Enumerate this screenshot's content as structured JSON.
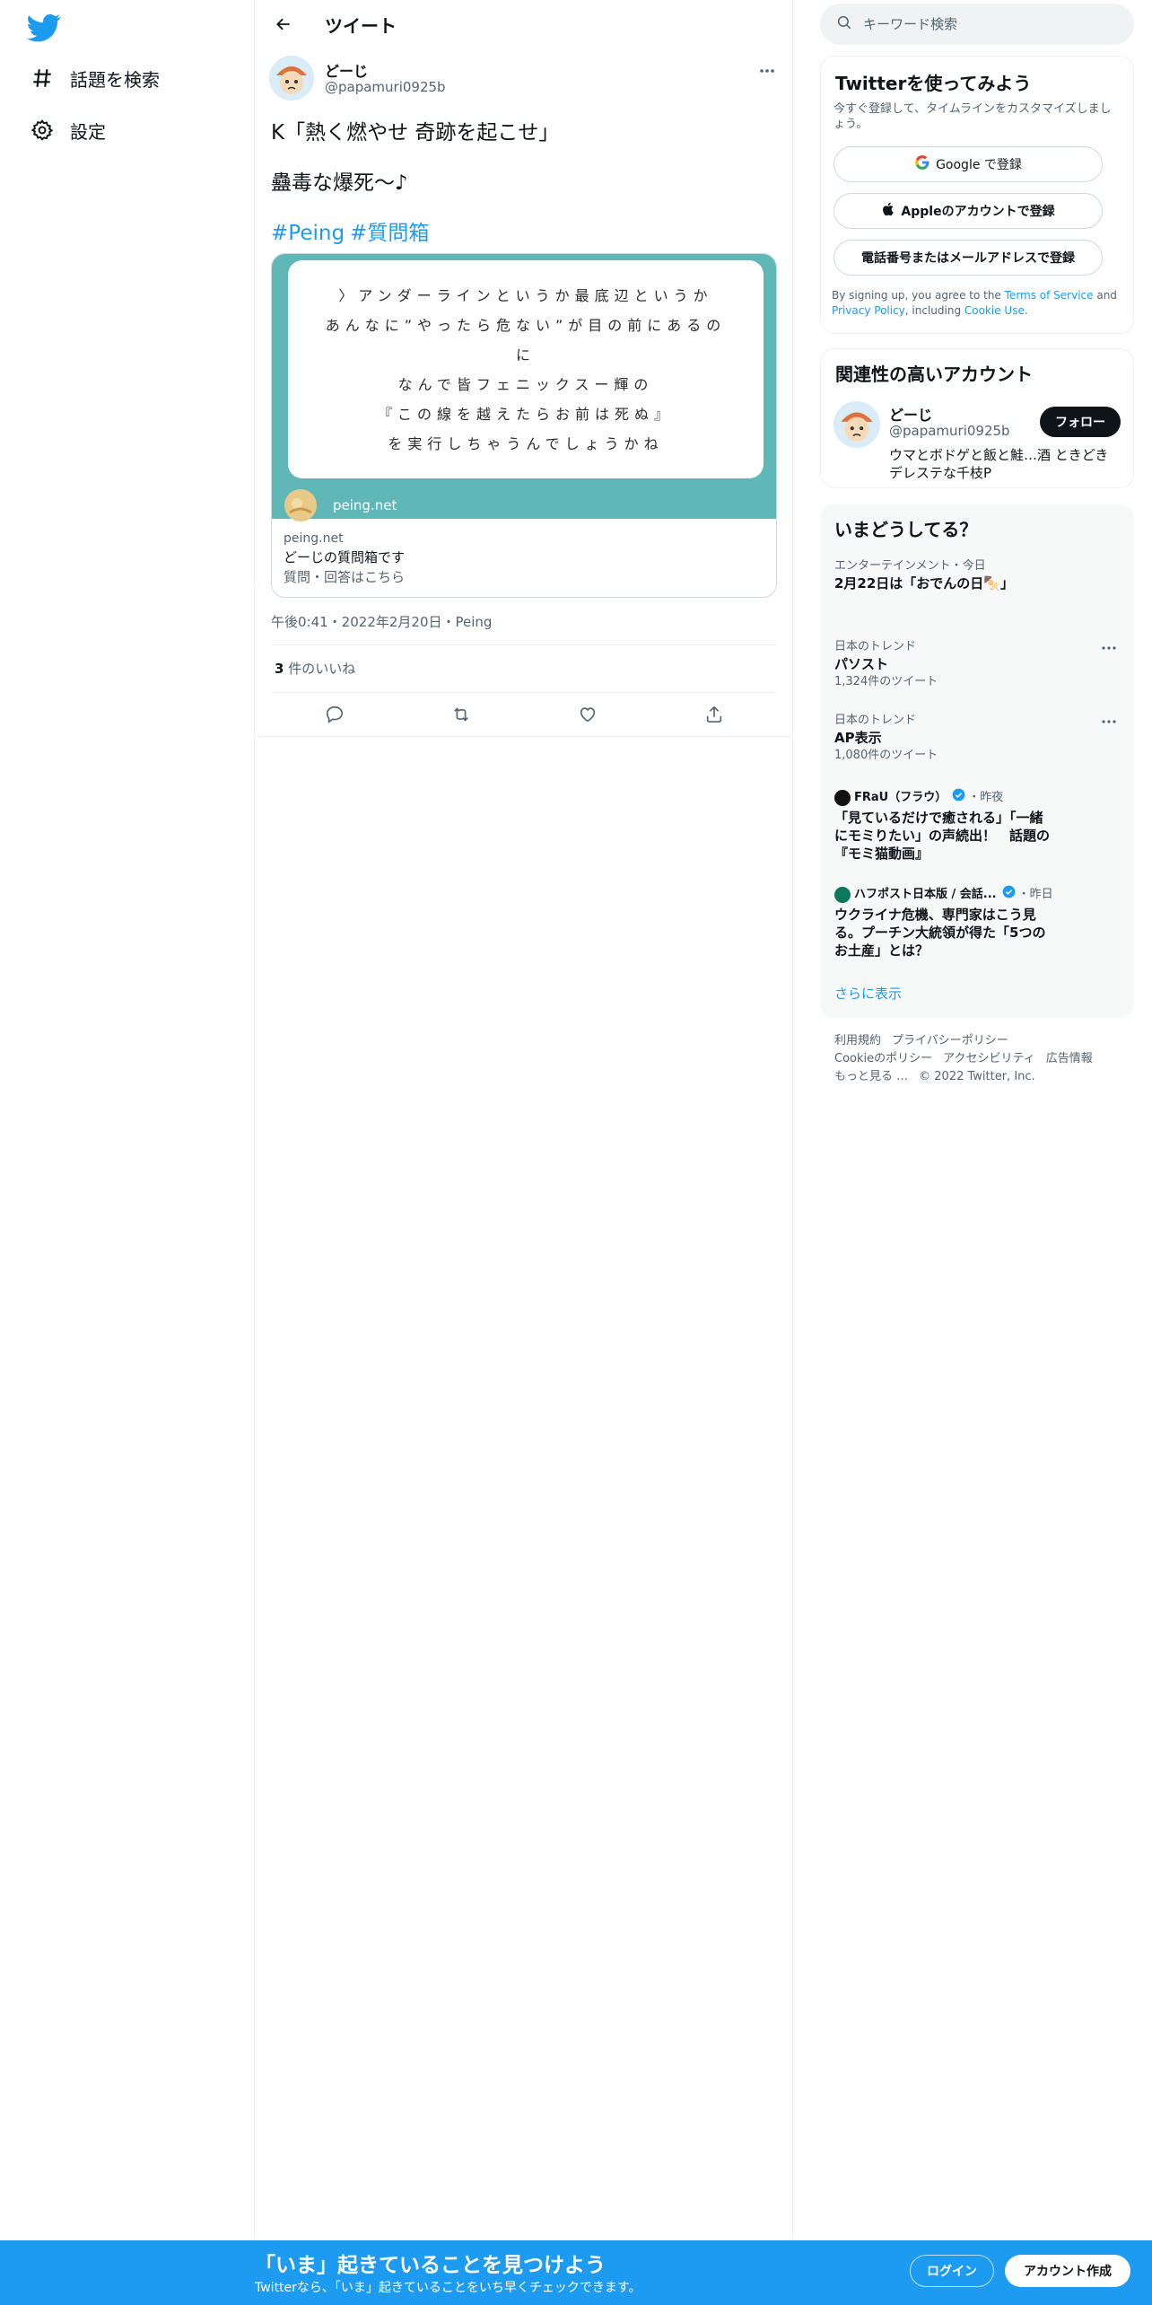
{
  "nav": {
    "items": [
      {
        "label": "話題を検索",
        "icon": "hashtag-icon"
      },
      {
        "label": "設定",
        "icon": "gear-icon"
      }
    ]
  },
  "header": {
    "title": "ツイート"
  },
  "tweet": {
    "author_name": "どーじ",
    "author_handle": "@papamuri0925b",
    "line1": "K「熱く燃やせ 奇跡を起こせ」",
    "line2": "蠱毒な爆死〜♪",
    "hashtags": [
      "#Peing",
      "#質問箱"
    ],
    "card": {
      "image_lines": [
        "〉アンダーラインというか最底辺というか",
        "あんなに”やったら危ない”が目の前にあるの",
        "に",
        "なんで皆フェニックスー輝の",
        "『この線を越えたらお前は死ぬ』",
        "を実行しちゃうんでしょうかね"
      ],
      "image_brand": "peing.net",
      "domain": "peing.net",
      "title": "どーじの質問箱です",
      "description": "質問・回答はこちら"
    },
    "timestamp": "午後0:41・2022年2月20日・Peing",
    "likes_count": "3",
    "likes_label": " 件のいいね"
  },
  "search": {
    "placeholder": "キーワード検索"
  },
  "signup": {
    "heading": "Twitterを使ってみよう",
    "subtext": "今すぐ登録して、タイムラインをカスタマイズしましょう。",
    "google_label": "Google で登録",
    "apple_label": "Appleのアカウントで登録",
    "phone_label": "電話番号またはメールアドレスで登録",
    "terms_prefix": "By signing up, you agree to the ",
    "terms_link": "Terms of Service",
    "terms_and": " and ",
    "privacy_link": "Privacy Policy",
    "terms_including": ", including ",
    "cookie_link": "Cookie Use",
    "terms_end": "."
  },
  "related": {
    "heading": "関連性の高いアカウント",
    "name": "どーじ",
    "handle": "@papamuri0925b",
    "follow_label": "フォロー",
    "bio": "ウマとボドゲと飯と鮭…酒 ときどきデレステな千枝P"
  },
  "trends": {
    "heading": "いまどうしてる？",
    "items": [
      {
        "context": "エンターテインメント・今日",
        "title": "2月22日は「おでんの日🍢」"
      },
      {
        "context": "日本のトレンド",
        "title": "パソスト",
        "count": "1,324件のツイート"
      },
      {
        "context": "日本のトレンド",
        "title": "AP表示",
        "count": "1,080件のツイート"
      }
    ],
    "news": [
      {
        "source": "FRaU（フラウ）",
        "when": "・昨夜",
        "headline": "「見ているだけで癒される」「一緒にモミりたい」の声続出！　話題の『モミ猫動画』"
      },
      {
        "source": "ハフポスト日本版 / 会話...",
        "when": "・昨日",
        "headline": "ウクライナ危機、専門家はこう見る。プーチン大統領が得た「5つのお土産」とは？"
      }
    ],
    "show_more": "さらに表示"
  },
  "footer": {
    "links": [
      "利用規約",
      "プライバシーポリシー",
      "Cookieのポリシー",
      "アクセシビリティ",
      "広告情報",
      "もっと見る …",
      "© 2022 Twitter, Inc."
    ]
  },
  "bottom_bar": {
    "heading": "「いま」起きていることを見つけよう",
    "subtext": "Twitterなら、「いま」起きていることをいち早くチェックできます。",
    "login_label": "ログイン",
    "signup_label": "アカウント作成"
  },
  "colors": {
    "accent": "#1d9bf0",
    "card_bg": "#5fb7b7",
    "text": "#0f1419",
    "muted": "#536471"
  }
}
